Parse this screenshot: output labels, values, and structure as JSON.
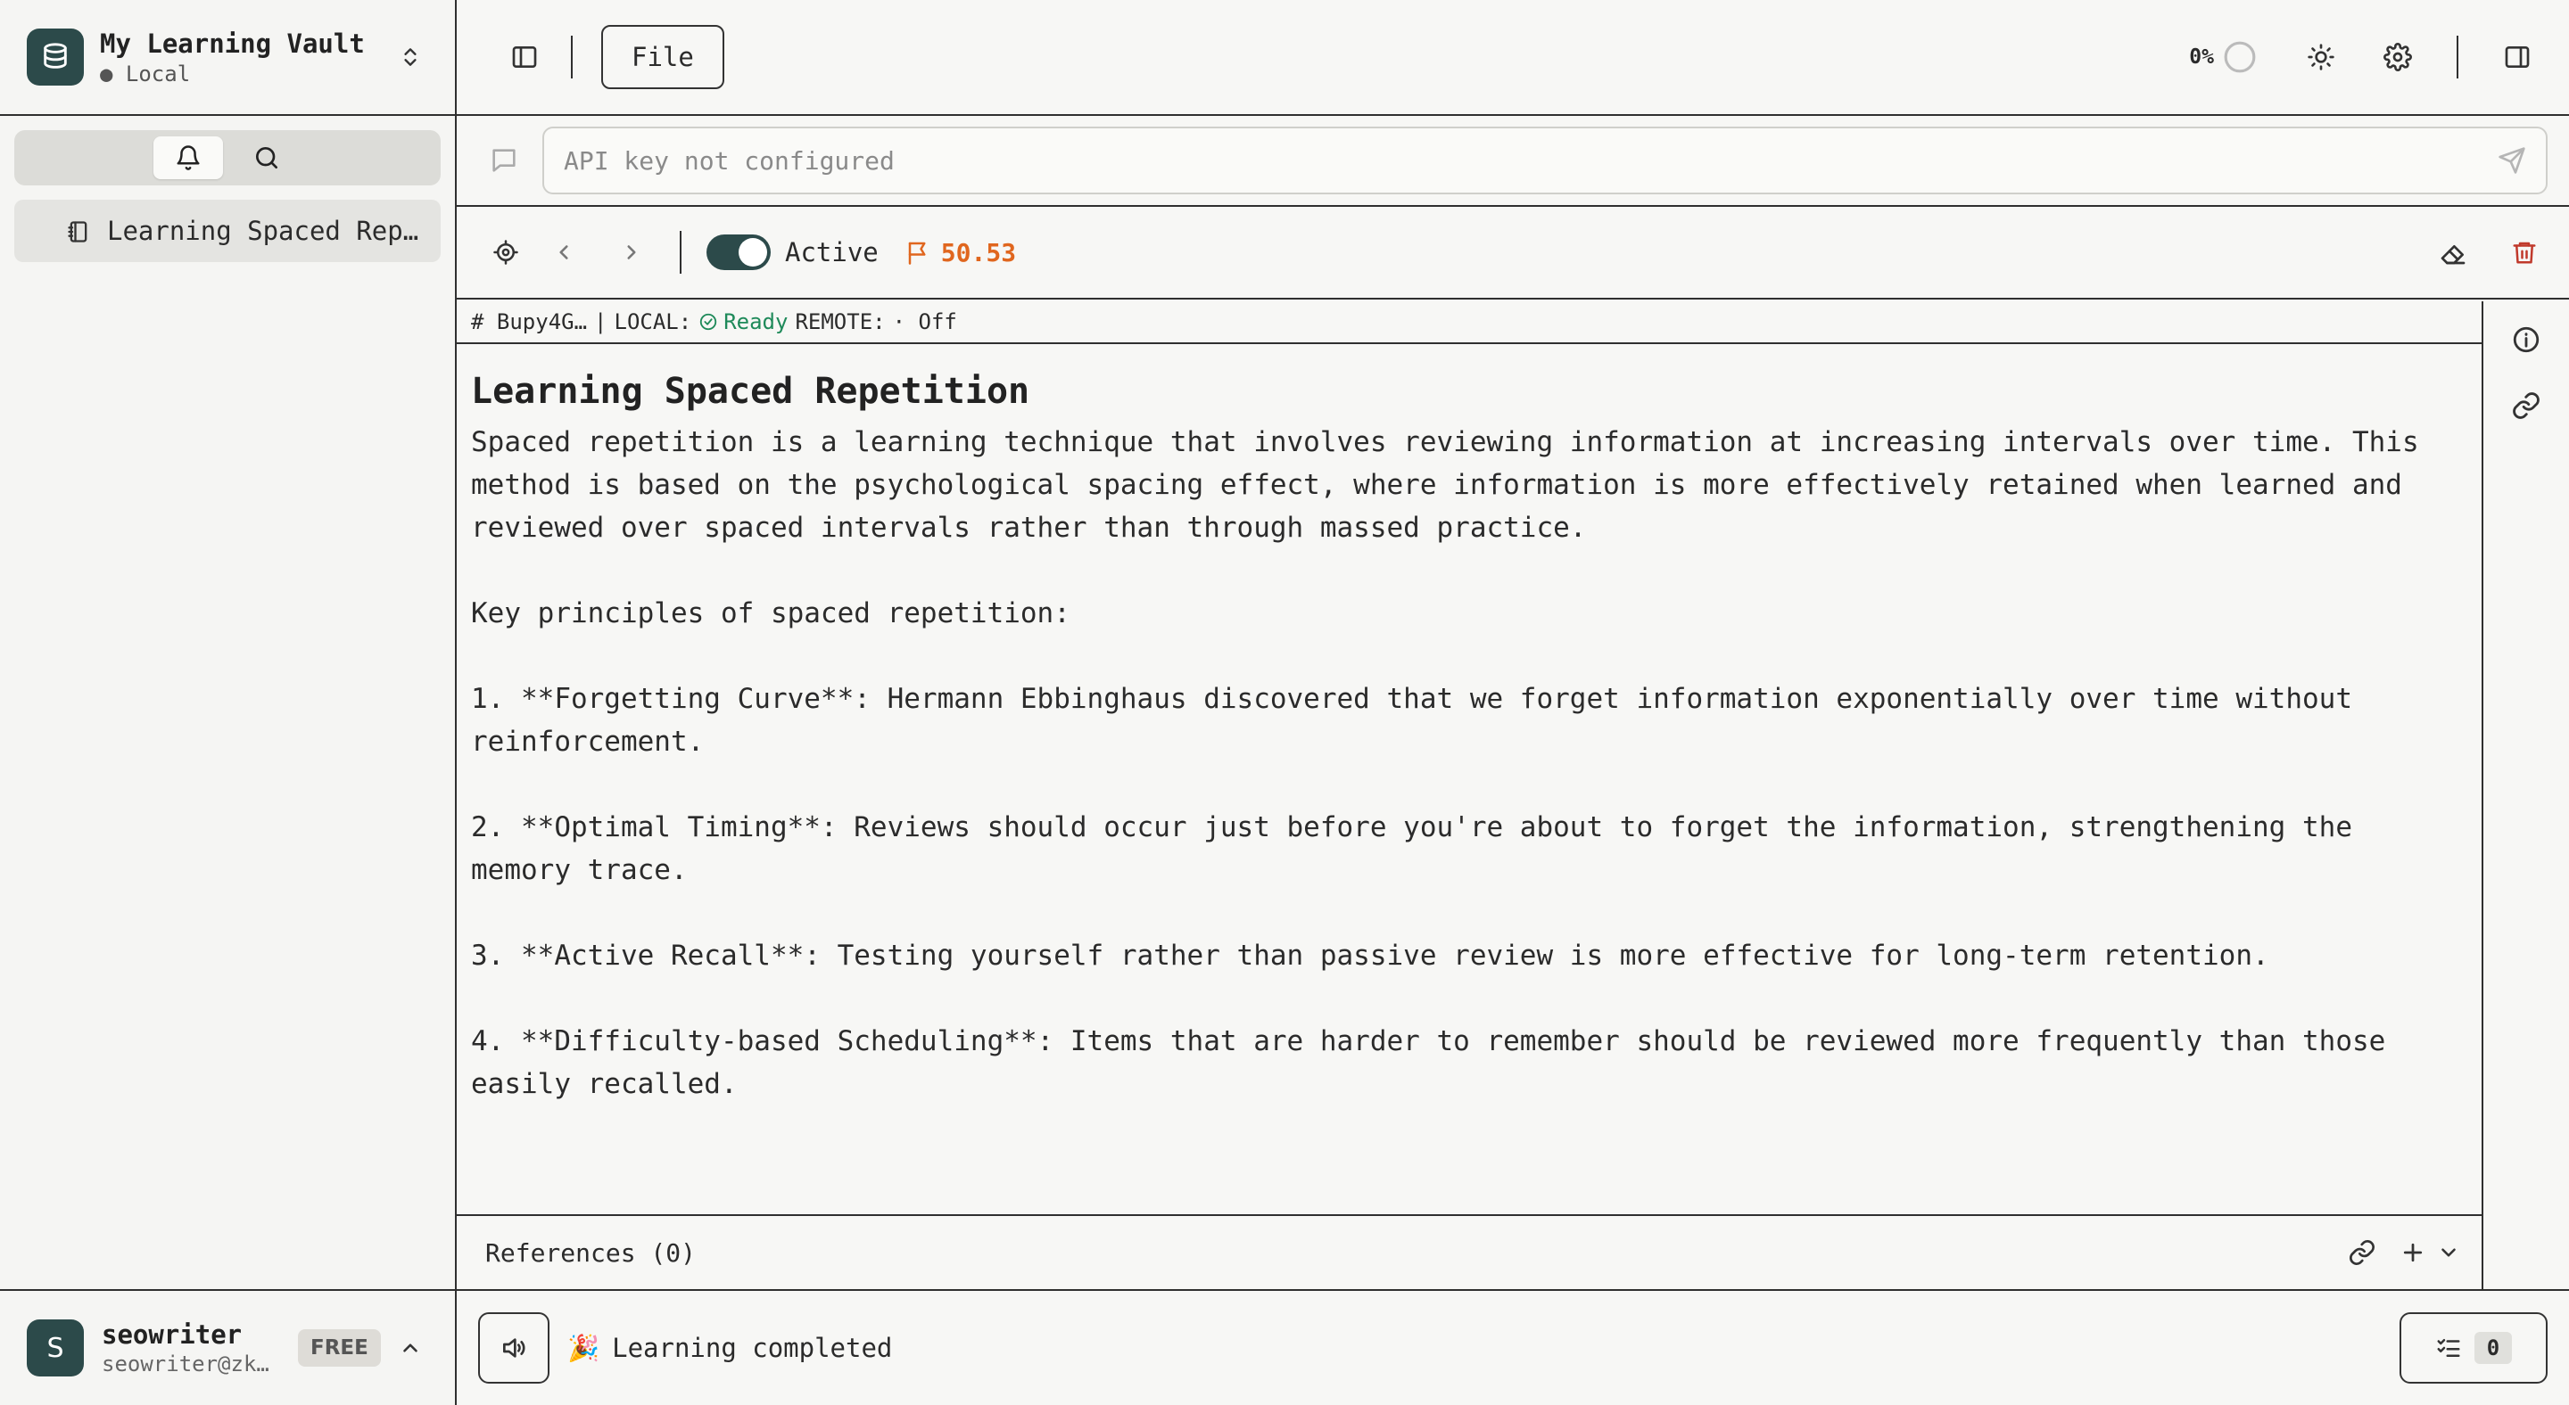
{
  "sidebar": {
    "vault_name": "My Learning Vault",
    "vault_location": "● Local",
    "tabs": [
      {
        "icon": "bell-icon",
        "active": true
      },
      {
        "icon": "search-icon",
        "active": false
      }
    ],
    "notes": [
      {
        "label": "Learning Spaced Repe…",
        "icon": "notebook-icon"
      }
    ],
    "user": {
      "initial": "S",
      "name": "seowriter",
      "email": "seowriter@zk…",
      "plan": "FREE"
    }
  },
  "topbar": {
    "file_label": "File",
    "progress": "0%",
    "progress_value": 0
  },
  "chat": {
    "placeholder": "API key not configured"
  },
  "toolbar": {
    "toggle_label": "Active",
    "toggle_on": true,
    "flag_value": "50.53",
    "flag_color": "#e0661e"
  },
  "status": {
    "id": "# Bupy4G…",
    "separator": "|",
    "local_label": "LOCAL:",
    "local_state": "Ready",
    "remote_label": "REMOTE:",
    "remote_state": "· Off"
  },
  "document": {
    "title": "Learning Spaced Repetition",
    "paragraphs": [
      "Spaced repetition is a learning technique that involves reviewing information at increasing intervals over time. This method is based on the psychological spacing effect, where information is more effectively retained when learned and reviewed over spaced intervals rather than through massed practice.",
      "Key principles of spaced repetition:",
      "1. **Forgetting Curve**: Hermann Ebbinghaus discovered that we forget information exponentially over time without reinforcement.",
      "2. **Optimal Timing**: Reviews should occur just before you're about to forget the information, strengthening the memory trace.",
      "3. **Active Recall**: Testing yourself rather than passive review is more effective for long-term retention.",
      "4. **Difficulty-based Scheduling**: Items that are harder to remember should be reviewed more frequently than those easily recalled."
    ]
  },
  "references": {
    "label": "References (0)"
  },
  "bottombar": {
    "status_emoji": "🎉",
    "status_text": "Learning completed",
    "task_count": "0"
  },
  "colors": {
    "accent": "#2c4a4a",
    "ready": "#1f8a5a",
    "danger": "#c0392b",
    "flag": "#e0661e"
  }
}
